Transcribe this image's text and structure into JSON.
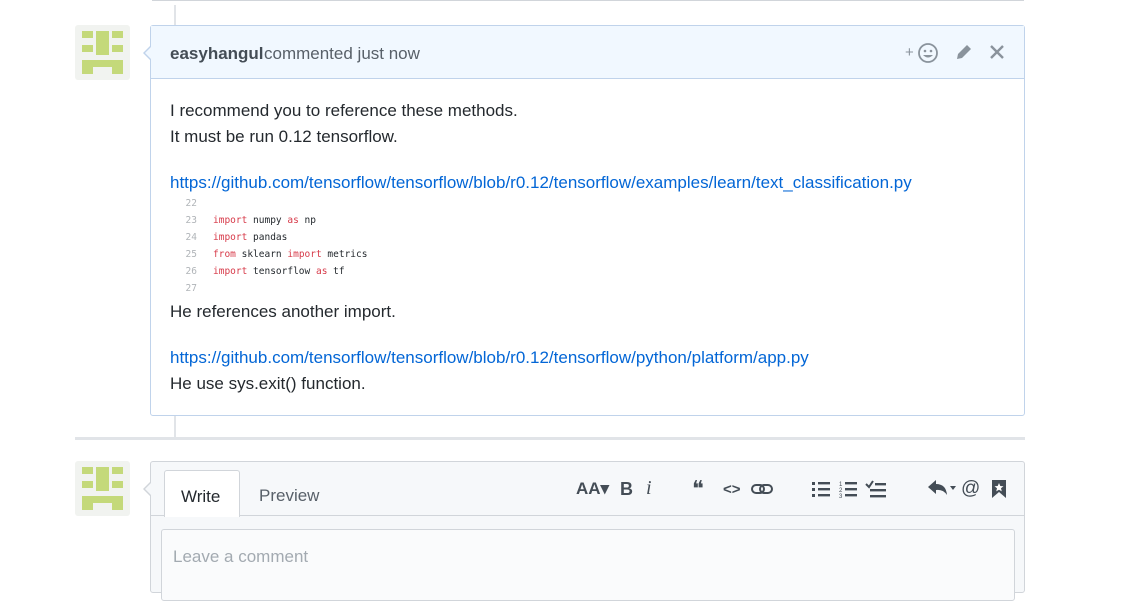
{
  "comment": {
    "author": "easyhangul",
    "action": "commented just now",
    "header_icons": [
      "add-reaction-icon",
      "pencil-icon",
      "close-icon"
    ],
    "lines": [
      "I recommend you to reference these methods.",
      "It must be run 0.12 tensorflow."
    ],
    "link1": "https://github.com/tensorflow/tensorflow/blob/r0.12/tensorflow/examples/learn/text_classification.py",
    "code_lines": [
      {
        "num": "22",
        "kw1": "",
        "text1": "",
        "kw2": "",
        "text2": ""
      },
      {
        "num": "23",
        "kw1": "import",
        "text1": " numpy ",
        "kw2": "as",
        "text2": " np"
      },
      {
        "num": "24",
        "kw1": "import",
        "text1": " pandas",
        "kw2": "",
        "text2": ""
      },
      {
        "num": "25",
        "kw1": "from",
        "text1": " sklearn ",
        "kw2": "import",
        "text2": " metrics"
      },
      {
        "num": "26",
        "kw1": "import",
        "text1": " tensorflow ",
        "kw2": "as",
        "text2": " tf"
      },
      {
        "num": "27",
        "kw1": "",
        "text1": "",
        "kw2": "",
        "text2": ""
      }
    ],
    "after_code": "He references another import.",
    "link2": "https://github.com/tensorflow/tensorflow/blob/r0.12/tensorflow/python/platform/app.py",
    "last_line": "He use sys.exit() function."
  },
  "editor": {
    "tab_write": "Write",
    "tab_preview": "Preview",
    "placeholder": "Leave a comment",
    "toolbar": {
      "heading": "AA▾",
      "bold": "B",
      "italic": "i",
      "quote": "❝",
      "code": "<>",
      "link": "⊂⊃",
      "bullets": "☰",
      "numbered": "☷",
      "tasks": "✓☰",
      "reply": "↩▾",
      "mention": "@",
      "bookmark": "bookmark-icon"
    }
  },
  "colors": {
    "accent_link": "#0366d6",
    "header_bg": "#f1f8ff",
    "avatar_green": "#c4d97a",
    "keyword": "#d73a49"
  }
}
